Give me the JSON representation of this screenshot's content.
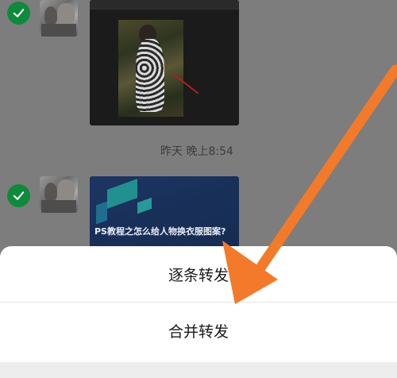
{
  "chat": {
    "timestamp": "昨天 晚上8:54",
    "article_title": "PS教程之怎么给人物换衣服图案?"
  },
  "sheet": {
    "forward_one_by_one": "逐条转发",
    "merge_forward": "合并转发"
  },
  "icons": {
    "check": "check-icon",
    "annotation": "arrow-icon"
  },
  "colors": {
    "check_green": "#0f8a3c",
    "annotation_arrow": "#f37a2a"
  }
}
